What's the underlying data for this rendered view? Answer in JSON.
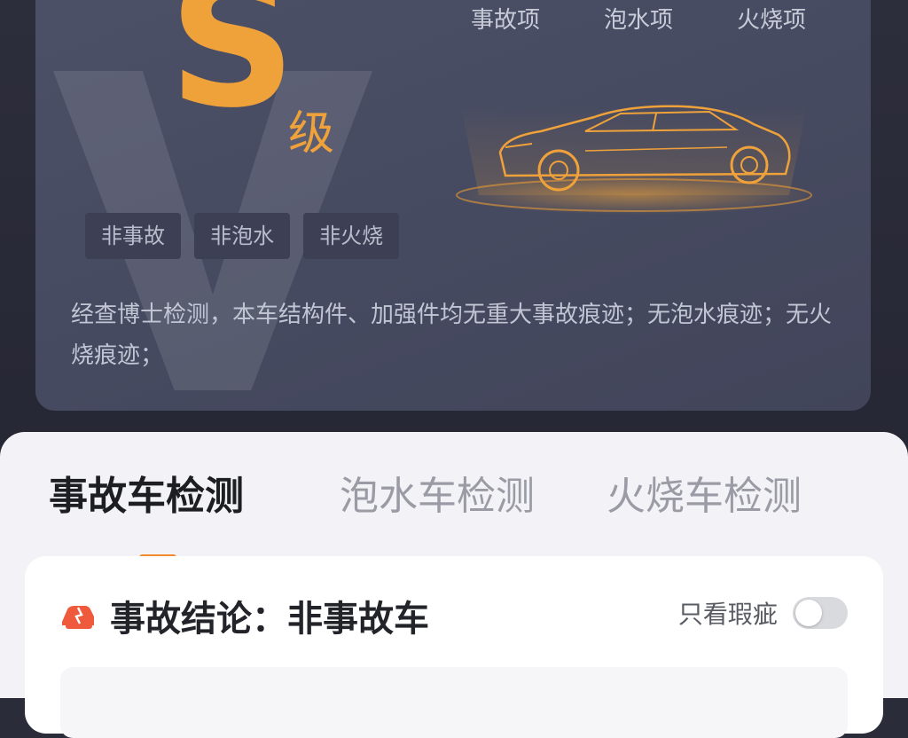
{
  "report": {
    "grade_letter": "S",
    "grade_suffix": "级",
    "check_items": [
      {
        "label": "事故项"
      },
      {
        "label": "泡水项"
      },
      {
        "label": "火烧项"
      }
    ],
    "tags": [
      "非事故",
      "非泡水",
      "非火烧"
    ],
    "description": "经查博士检测，本车结构件、加强件均无重大事故痕迹；无泡水痕迹；无火烧痕迹；",
    "accent_color": "#f0a23a"
  },
  "tabs": [
    {
      "label": "事故车检测",
      "active": true
    },
    {
      "label": "泡水车检测",
      "active": false
    },
    {
      "label": "火烧车检测",
      "active": false
    }
  ],
  "conclusion": {
    "icon": "car-accident-icon",
    "title": "事故结论：非事故车",
    "filter_label": "只看瑕疵",
    "filter_on": false
  }
}
